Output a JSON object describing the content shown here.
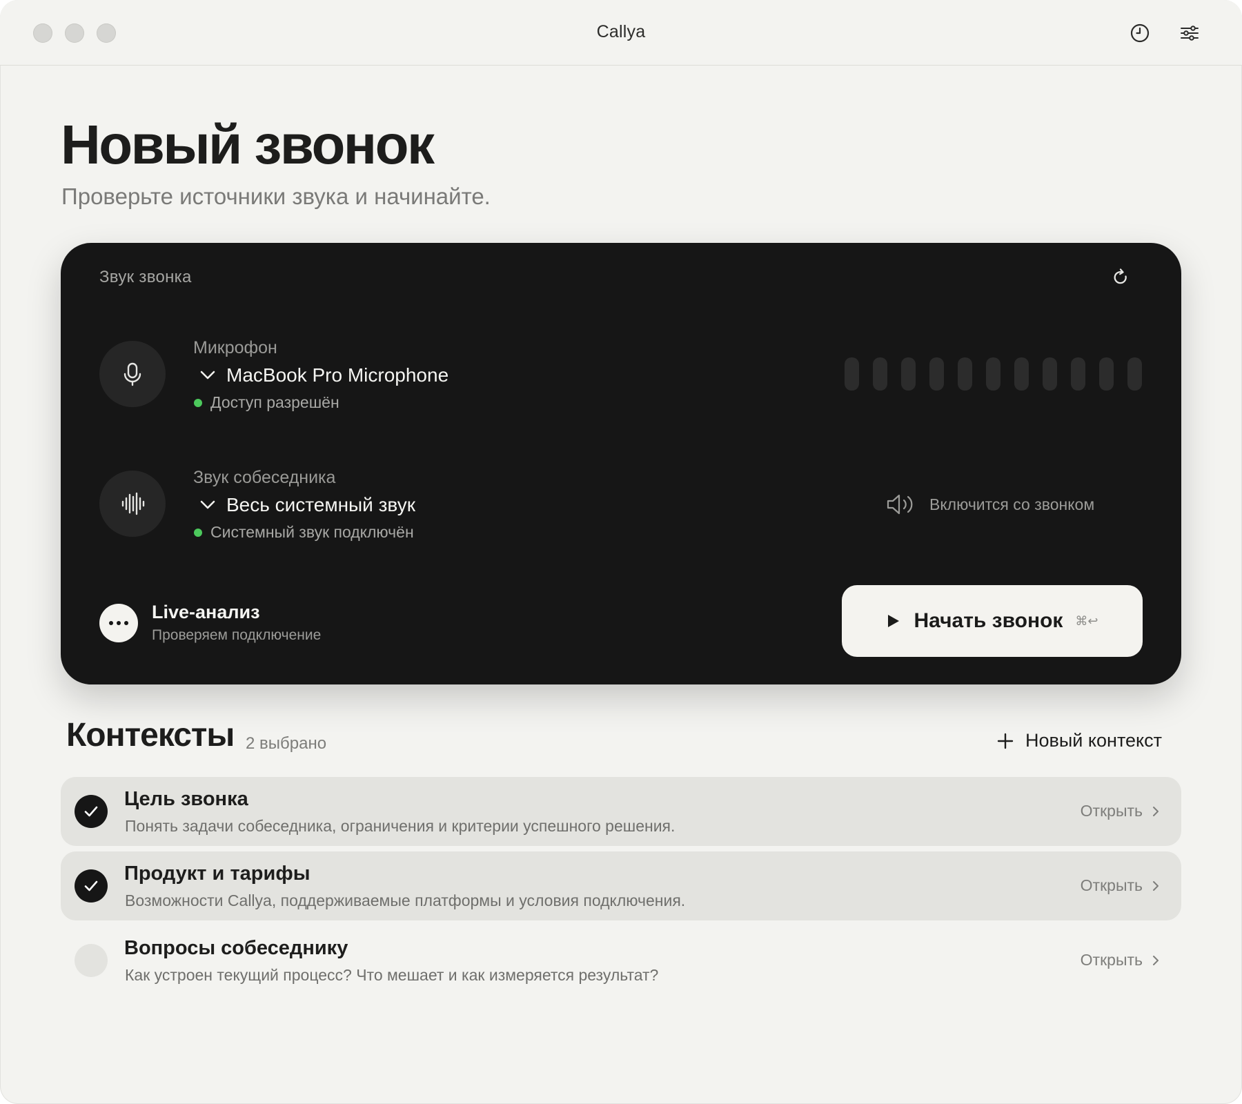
{
  "window": {
    "title": "Callya"
  },
  "page": {
    "title": "Новый звонок",
    "subtitle": "Проверьте источники звука и начинайте."
  },
  "audio_card": {
    "label": "Звук звонка",
    "microphone": {
      "label": "Микрофон",
      "device": "MacBook Pro Microphone",
      "status": "Доступ разрешён",
      "status_color": "#4cc95c",
      "level_bars": 11
    },
    "remote": {
      "label": "Звук собеседника",
      "device": "Весь системный звук",
      "status": "Системный звук подключён",
      "status_color": "#4cc95c",
      "note": "Включится со звонком"
    },
    "live": {
      "title": "Live-анализ",
      "subtitle": "Проверяем подключение"
    },
    "start_button": {
      "label": "Начать звонок",
      "shortcut": "⌘↩"
    }
  },
  "contexts": {
    "title": "Контексты",
    "selected_count": "2 выбрано",
    "new_label": "Новый контекст",
    "items": [
      {
        "name": "Цель звонка",
        "description": "Понять задачи собеседника, ограничения и критерии успешного решения.",
        "action": "Открыть",
        "selected": true
      },
      {
        "name": "Продукт и тарифы",
        "description": "Возможности Callya, поддерживаемые платформы и условия подключения.",
        "action": "Открыть",
        "selected": true
      },
      {
        "name": "Вопросы собеседнику",
        "description": "Как устроен текущий процесс? Что мешает и как измеряется результат?",
        "action": "Открыть",
        "selected": false
      }
    ]
  },
  "colors": {
    "background": "#f3f3f0",
    "card": "#161616",
    "accent_green": "#4cc95c",
    "selected_row": "#e3e3df"
  }
}
